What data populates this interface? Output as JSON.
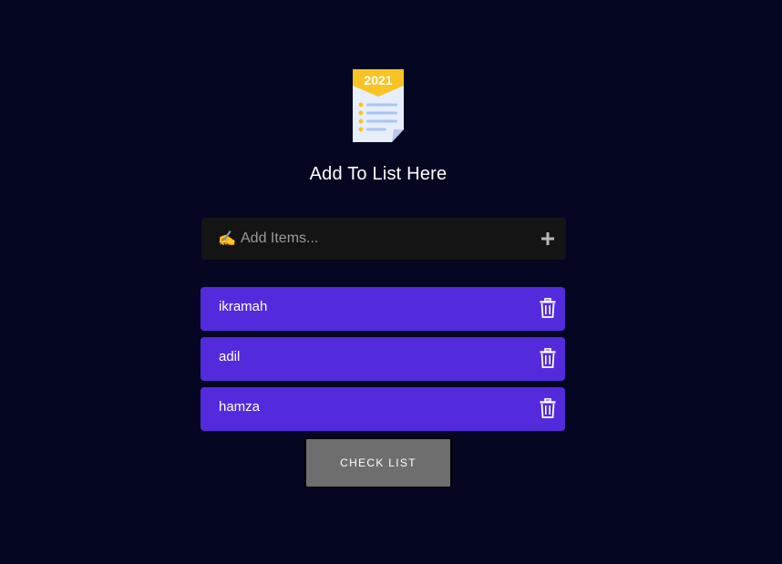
{
  "header": {
    "logo_year": "2021",
    "logo_icon": "checklist-document-icon",
    "title": "Add To List Here"
  },
  "add_bar": {
    "emoji": "✍️",
    "placeholder": "Add Items...",
    "value": "",
    "add_icon": "plus-icon"
  },
  "items": [
    {
      "label": "ikramah",
      "delete_icon": "trash-icon"
    },
    {
      "label": "adil",
      "delete_icon": "trash-icon"
    },
    {
      "label": "hamza",
      "delete_icon": "trash-icon"
    }
  ],
  "actions": {
    "check_list_label": "CHECK LIST"
  },
  "colors": {
    "background": "#050622",
    "input_bg": "#141414",
    "item_bg": "#532bdc",
    "button_bg": "#6e6e6e",
    "logo_banner": "#f7c325"
  }
}
